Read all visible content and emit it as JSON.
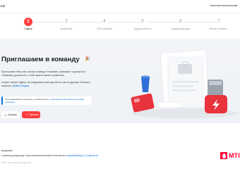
{
  "header": {
    "brand": "LO",
    "user_name": "Константинопольский"
  },
  "stepper": {
    "steps": [
      {
        "number": "2",
        "label": "Оффер"
      },
      {
        "number": "3",
        "label": "Документы"
      },
      {
        "number": "4",
        "label": "ЛНА компании"
      },
      {
        "number": "5",
        "label": "Трудоустройство"
      },
      {
        "number": "6",
        "label": "Трудовой договор"
      },
      {
        "number": "7",
        "label": "Выход в первый..."
      }
    ],
    "active_index": 0
  },
  "hero": {
    "title": "Приглашаем в команду",
    "paragraph1": "Приглашаем тебя стать частью команды «Название_Компании» в должности «Название_должности», чтобы вместе менять привычное",
    "paragraph2": "Скорее смотри оффер, на следующем шаге сделай это уже по-другому Остались вопросы?",
    "discuss_link": "Давай обсудим",
    "notice_text": "Пока принимаешь решение, узнай больше",
    "notice_link": "о преимуществах работы в нашей компании",
    "download_button": "Скачать",
    "accept_button": "Принять"
  },
  "footer": {
    "question": "вопросы?",
    "contact_prefix": "к своему рекрутеру: Константинопольский Константин,",
    "contact_email": "konstantinopol_k_k@mts.ru",
    "copyright": "©МТС Все права защищены ПР",
    "logo_text": "МТС J"
  },
  "colors": {
    "accent": "#ff3d3d",
    "link": "#0070e5",
    "hero_bg": "#f3f5f8",
    "brand_red": "#ff0032"
  }
}
